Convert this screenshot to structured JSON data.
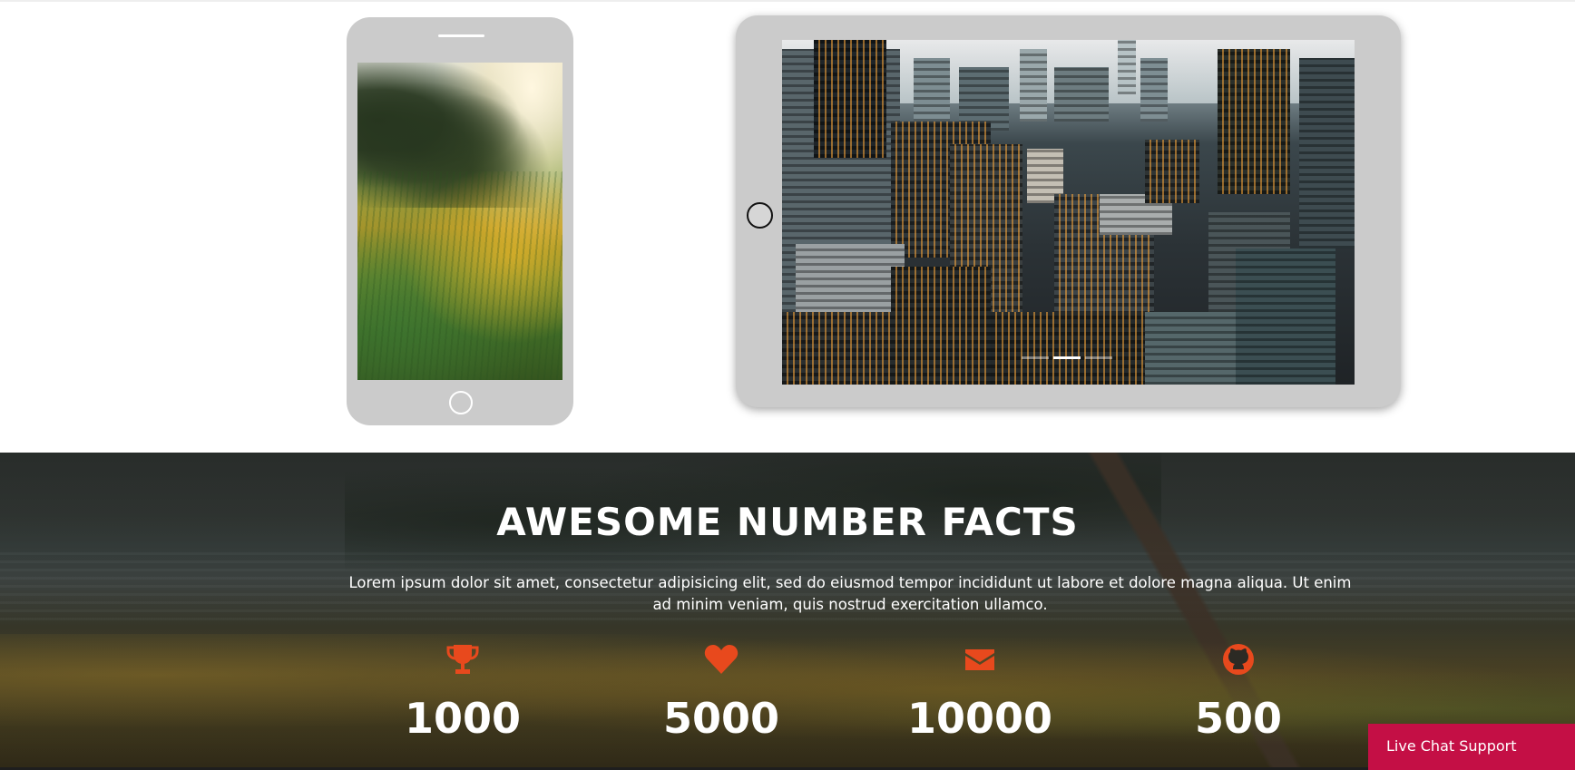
{
  "facts": {
    "title": "AWESOME NUMBER FACTS",
    "description": "Lorem ipsum dolor sit amet, consectetur adipisicing elit, sed do eiusmod tempor incididunt ut labore et dolore magna aliqua. Ut enim ad minim veniam, quis nostrud exercitation ullamco.",
    "accent_color": "#e8491d",
    "items": [
      {
        "icon": "trophy-icon",
        "number": "1000"
      },
      {
        "icon": "heart-icon",
        "number": "5000"
      },
      {
        "icon": "envelope-icon",
        "number": "10000"
      },
      {
        "icon": "github-icon",
        "number": "500"
      }
    ]
  },
  "tablet_slider": {
    "slides": 3,
    "active_slide": 2
  },
  "live_chat": {
    "label": "Live Chat Support",
    "color": "#c40f45"
  }
}
